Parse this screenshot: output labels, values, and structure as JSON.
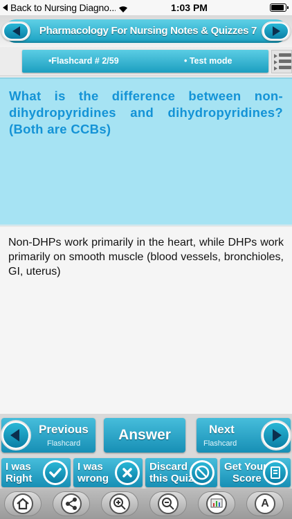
{
  "status_bar": {
    "back_label": "Back to Nursing Diagno...",
    "time": "1:03 PM"
  },
  "header": {
    "title": "Pharmacology For Nursing  Notes & Quizzes 7"
  },
  "info_bar": {
    "flashcard_label": "•Flashcard # ",
    "flashcard_position": "2/59",
    "mode_label": "• Test mode"
  },
  "question": {
    "text": "What is the difference between non-dihydropyridines and dihydropyridines? (Both are CCBs)"
  },
  "answer": {
    "text": "Non-DHPs work primarily in the heart, while DHPs work primarily on smooth muscle (blood vessels, bronchioles, GI, uterus)"
  },
  "nav_buttons": {
    "previous_main": "Previous",
    "previous_sub": "Flashcard",
    "answer": "Answer",
    "next_main": "Next",
    "next_sub": "Flashcard"
  },
  "actions": {
    "right_l1": "I was",
    "right_l2": "Right",
    "wrong_l1": "I was",
    "wrong_l2": "wrong",
    "discard_l1": "Discard",
    "discard_l2": "this Quiz",
    "score_l1": "Get Your",
    "score_l2": "Score"
  },
  "toolbar": {
    "icons": [
      "home-icon",
      "share-icon",
      "zoom-in-icon",
      "zoom-out-icon",
      "chart-icon",
      "font-size-icon"
    ],
    "font_letter": "A"
  },
  "colors": {
    "accent": "#1aa1c2",
    "question_bg": "#a6e3f3",
    "question_text": "#1493d6"
  }
}
